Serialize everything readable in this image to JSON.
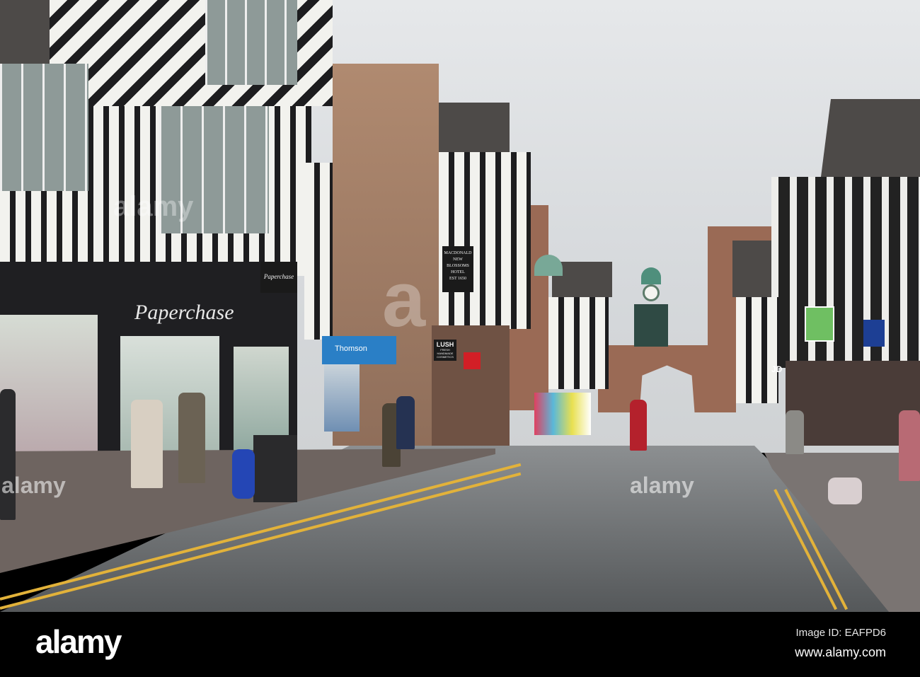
{
  "photo": {
    "signs": {
      "paperchase": "Paperchase",
      "paperchase_small": "Paperchase",
      "hotel": [
        "MACDONALD",
        "NEW",
        "BLOSSOMS",
        "HOTEL",
        "EST 1650"
      ],
      "lush": [
        "LUSH",
        "FRESH",
        "HANDMADE",
        "COSMETICS"
      ],
      "thomson": "Thomson",
      "jd": "JD"
    },
    "watermarks": [
      "alamy",
      "alamy",
      "a",
      "alamy"
    ]
  },
  "footer": {
    "logo": "alamy",
    "image_id": "Image ID: EAFPD6",
    "url": "www.alamy.com"
  }
}
